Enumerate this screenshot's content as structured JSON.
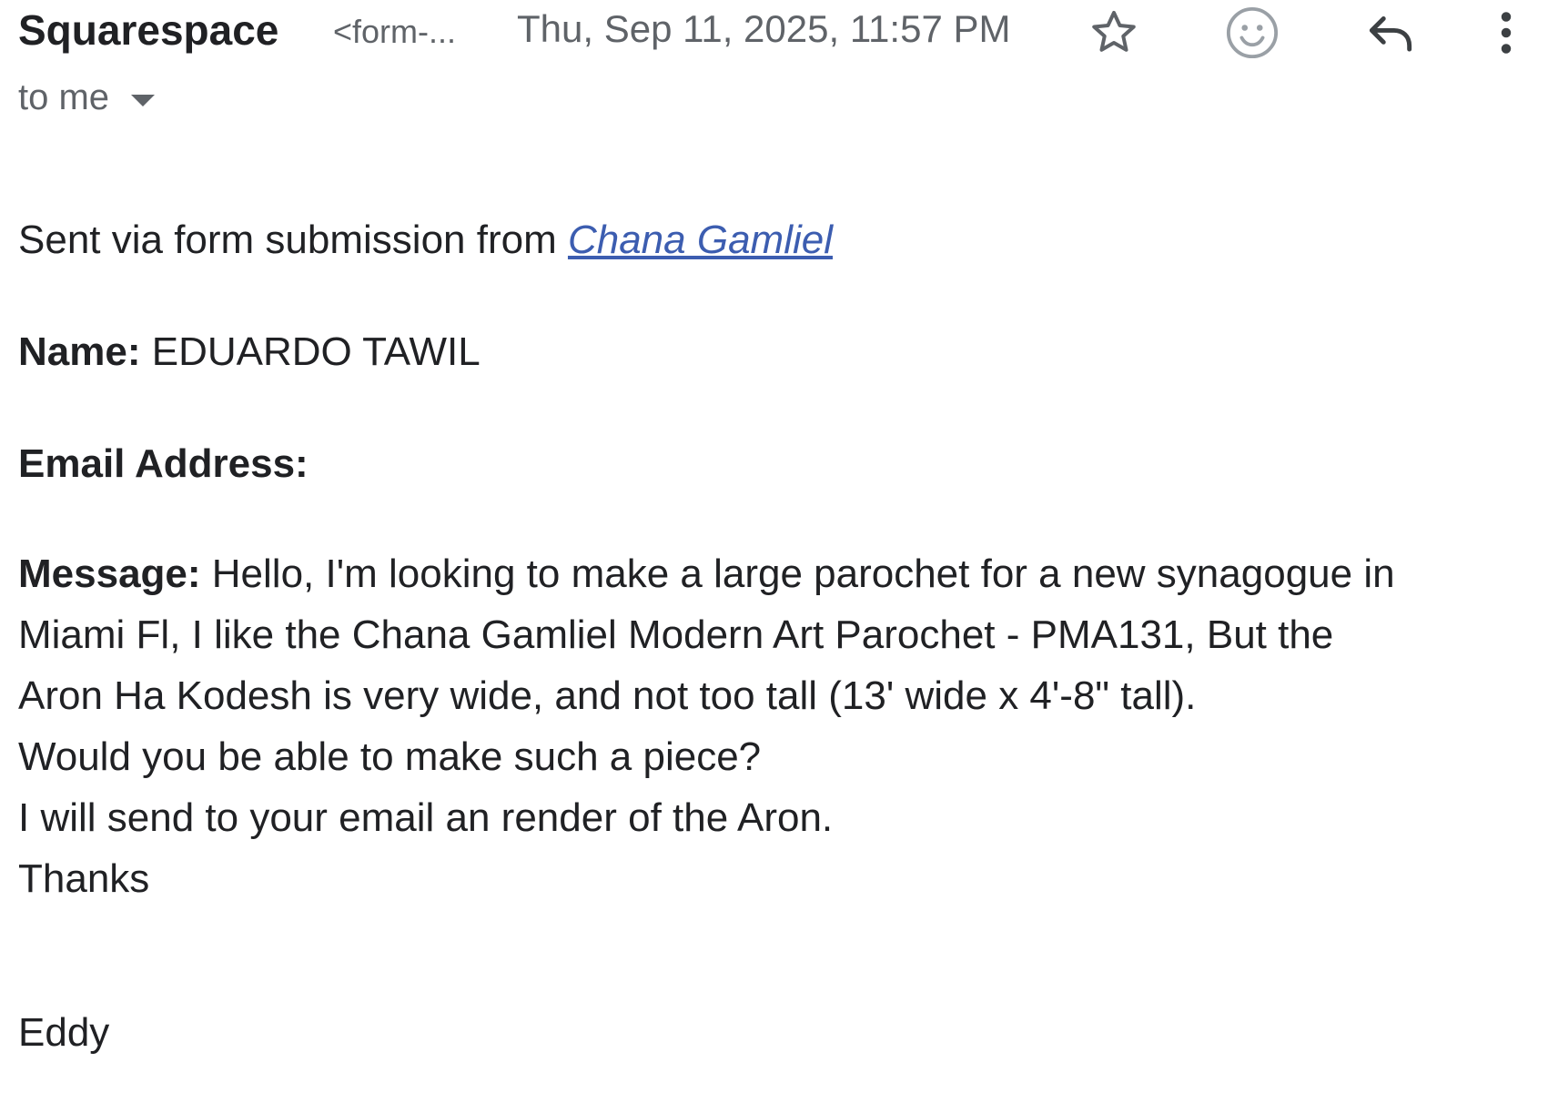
{
  "header": {
    "sender_name": "Squarespace",
    "sender_email_truncated": "<form-...",
    "date": "Thu, Sep 11, 2025, 11:57 PM",
    "star_icon": "star-outline-icon",
    "emoji_icon": "add-reaction-icon",
    "reply_icon": "reply-icon",
    "more_icon": "more-vert-icon"
  },
  "recipient": {
    "label": "to me",
    "caret_icon": "caret-down-icon"
  },
  "body": {
    "sent_prefix": "Sent via form submission from ",
    "sent_link": "Chana Gamliel",
    "name_label": "Name:",
    "name_value": " EDUARDO TAWIL",
    "email_label": "Email Address:",
    "message_label": "Message:",
    "message_lines": [
      " Hello, I'm looking to make a large parochet for a new synagogue in",
      "Miami Fl, I like the Chana Gamliel Modern Art Parochet - PMA131, But the",
      "Aron Ha Kodesh is very wide, and not too tall (13' wide x 4'-8\" tall).",
      "Would you be able to make such a piece?",
      "I will send to your email an render of the Aron.",
      "Thanks"
    ],
    "signature": "Eddy"
  },
  "colors": {
    "text_primary": "#202124",
    "text_secondary": "#5f6368",
    "link": "#3c5db0",
    "background": "#ffffff"
  }
}
